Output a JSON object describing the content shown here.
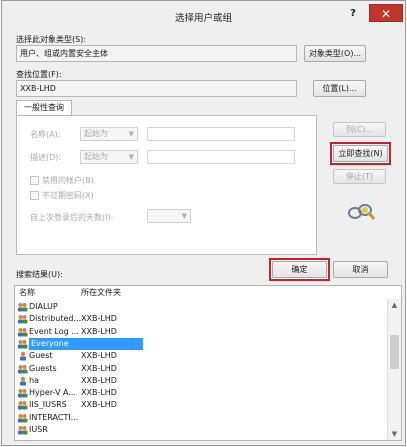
{
  "dialog": {
    "title": "选择用户或组",
    "help_glyph": "?",
    "close_glyph": "✕"
  },
  "object_type": {
    "label": "选择此对象类型(S):",
    "value": "用户、组或内置安全主体",
    "button": "对象类型(O)..."
  },
  "location": {
    "label": "查找位置(F):",
    "value": "XXB-LHD",
    "button": "位置(L)..."
  },
  "tab": {
    "label": "一般性查询"
  },
  "query": {
    "name_label": "名称(A):",
    "name_mode": "起始为",
    "desc_label": "描述(D):",
    "desc_mode": "起始为",
    "disabled_accounts": "禁用的帐户(B)",
    "non_expiring_pw": "不过期密码(X)",
    "days_label": "自上次登录后的天数(I):"
  },
  "side_buttons": {
    "columns": "列(C)...",
    "find_now": "立即查找(N)",
    "stop": "停止(T)"
  },
  "search_results": {
    "label": "搜索结果(U):"
  },
  "footer": {
    "ok": "确定",
    "cancel": "取消"
  },
  "table": {
    "headers": [
      "名称",
      "所在文件夹"
    ],
    "rows": [
      {
        "name": "DIALUP",
        "folder": "",
        "icon": "group-icon"
      },
      {
        "name": "Distributed...",
        "folder": "XXB-LHD",
        "icon": "group-icon"
      },
      {
        "name": "Event Log ...",
        "folder": "XXB-LHD",
        "icon": "group-icon"
      },
      {
        "name": "Everyone",
        "folder": "",
        "icon": "group-icon",
        "selected": true
      },
      {
        "name": "Guest",
        "folder": "XXB-LHD",
        "icon": "user-icon"
      },
      {
        "name": "Guests",
        "folder": "XXB-LHD",
        "icon": "group-icon"
      },
      {
        "name": "ha",
        "folder": "XXB-LHD",
        "icon": "user-icon"
      },
      {
        "name": "Hyper-V A...",
        "folder": "XXB-LHD",
        "icon": "group-icon"
      },
      {
        "name": "IIS_IUSRS",
        "folder": "XXB-LHD",
        "icon": "group-icon"
      },
      {
        "name": "INTERACTI...",
        "folder": "",
        "icon": "group-icon"
      },
      {
        "name": "IUSR",
        "folder": "",
        "icon": "group-icon"
      }
    ]
  },
  "colors": {
    "highlight": "#c0272d",
    "selection": "#3399ff",
    "close": "#c1362c"
  }
}
